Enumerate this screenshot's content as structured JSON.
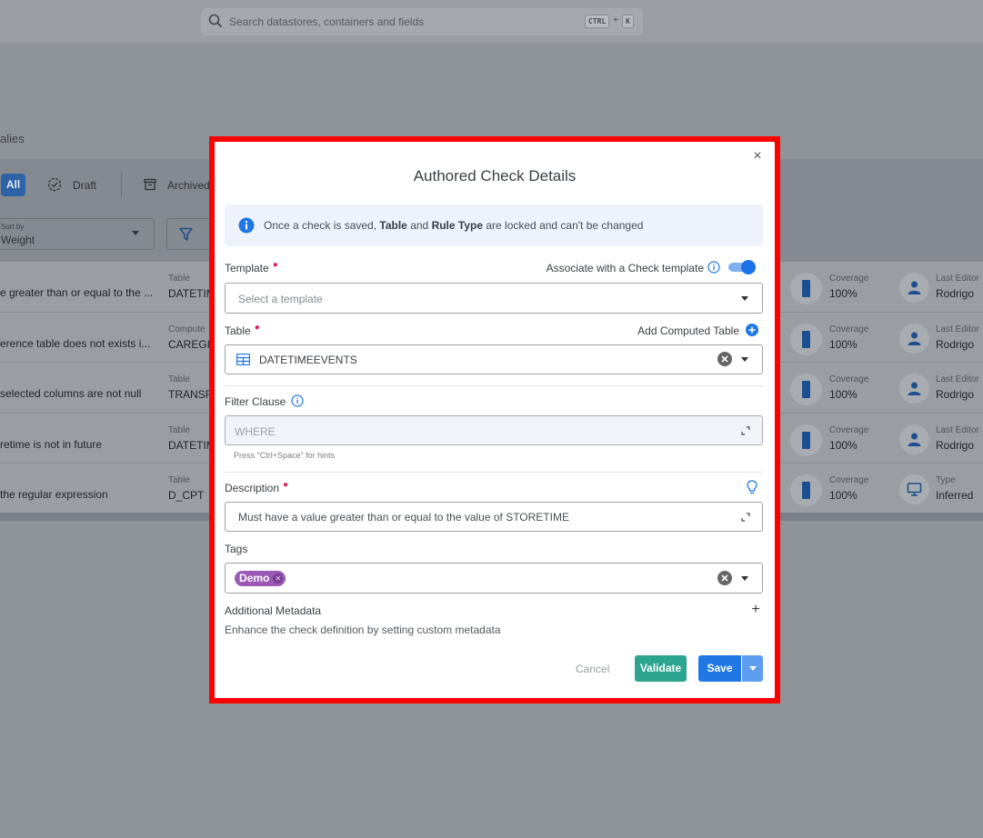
{
  "app": {
    "search_placeholder": "Search datastores, containers and fields",
    "shortcut_ctrl": "CTRL",
    "shortcut_plus": "+",
    "shortcut_key": "K",
    "page_subtitle": "alies",
    "tabs": {
      "all": "All",
      "draft": "Draft",
      "archived": "Archived"
    },
    "sort_label": "Sort by",
    "sort_value": "Weight"
  },
  "rows": [
    {
      "desc": "e greater than or equal to the ...",
      "table_label": "Table",
      "table_value": "DATETIM",
      "cov_label": "Coverage",
      "cov_value": "100%",
      "ed_label": "Last Editor",
      "ed_value": "Rodrigo",
      "ed_icon": "user-icon"
    },
    {
      "desc": "erence table does not exists i...",
      "table_label": "Compute",
      "table_value": "CAREGIV",
      "cov_label": "Coverage",
      "cov_value": "100%",
      "ed_label": "Last Editor",
      "ed_value": "Rodrigo",
      "ed_icon": "user-icon"
    },
    {
      "desc": "selected columns are not null",
      "table_label": "Table",
      "table_value": "TRANSF",
      "cov_label": "Coverage",
      "cov_value": "100%",
      "ed_label": "Last Editor",
      "ed_value": "Rodrigo",
      "ed_icon": "user-icon"
    },
    {
      "desc": "retime is not in future",
      "table_label": "Table",
      "table_value": "DATETIM",
      "cov_label": "Coverage",
      "cov_value": "100%",
      "ed_label": "Last Editor",
      "ed_value": "Rodrigo",
      "ed_icon": "user-icon"
    },
    {
      "desc": "the regular expression",
      "table_label": "Table",
      "table_value": "D_CPT",
      "cov_label": "Coverage",
      "cov_value": "100%",
      "ed_label": "Type",
      "ed_value": "Inferred",
      "ed_icon": "monitor-icon"
    }
  ],
  "modal": {
    "title": "Authored Check Details",
    "info": {
      "pre": "Once a check is saved, ",
      "table": "Table",
      "and": " and ",
      "rule_type": "Rule Type",
      "post": " are locked and can't be changed"
    },
    "template_label": "Template",
    "associate_label": "Associate with a Check template",
    "associate_enabled": true,
    "template_placeholder": "Select a template",
    "table_label": "Table",
    "add_computed_label": "Add Computed Table",
    "table_value": "DATETIMEEVENTS",
    "filter_label": "Filter Clause",
    "filter_placeholder": "WHERE",
    "filter_hint": "Press \"Ctrl+Space\" for hints",
    "description_label": "Description",
    "description_value": "Must have a value greater than or equal to the value of STORETIME",
    "tags_label": "Tags",
    "tags": [
      "Demo"
    ],
    "metadata_title": "Additional Metadata",
    "metadata_plus": "+",
    "metadata_desc": "Enhance the check definition by setting custom metadata",
    "cancel": "Cancel",
    "validate": "Validate",
    "save": "Save",
    "close": "×"
  },
  "colors": {
    "primary": "#1f78e6",
    "validate": "#2ba58f",
    "tag": "#9b59b6",
    "highlight": "#ff0000",
    "required": "#e0245e"
  }
}
